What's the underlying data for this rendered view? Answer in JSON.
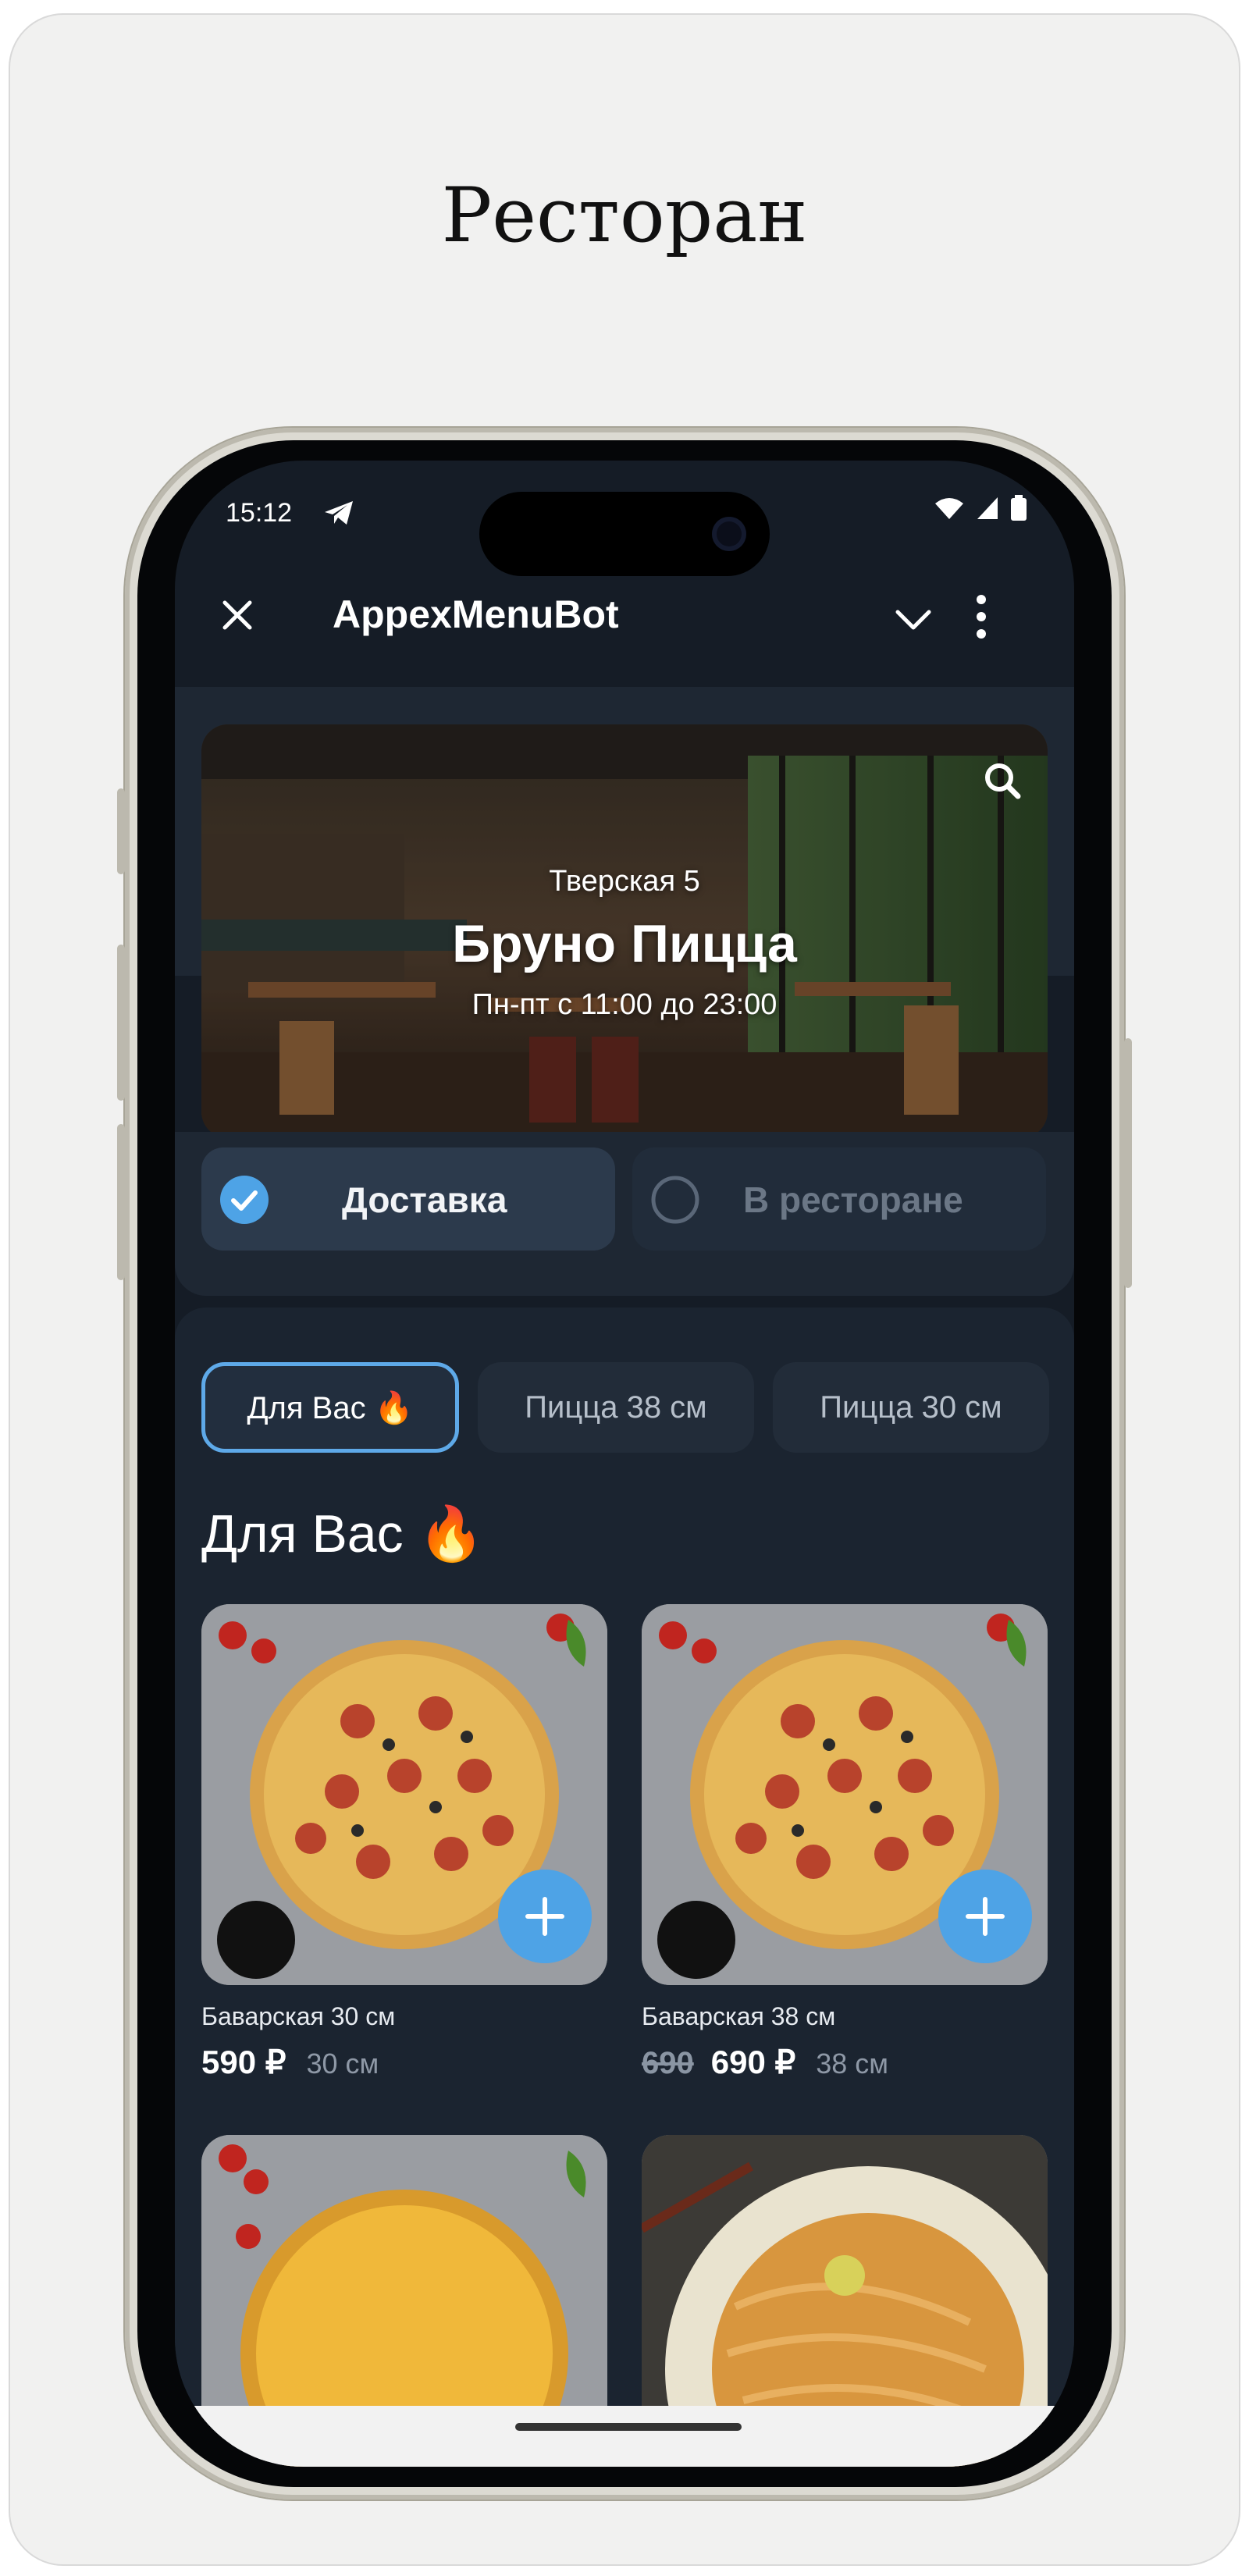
{
  "page": {
    "title": "Ресторан"
  },
  "status_bar": {
    "time": "15:12"
  },
  "header": {
    "title": "AppexMenuBot"
  },
  "hero": {
    "address": "Тверская 5",
    "restaurant_name": "Бруно Пицца",
    "hours": "Пн-пт с 11:00 до 23:00"
  },
  "order_mode": {
    "options": [
      {
        "label": "Доставка",
        "selected": true
      },
      {
        "label": "В ресторане",
        "selected": false
      }
    ]
  },
  "categories": [
    {
      "label": "Для Вас 🔥",
      "active": true
    },
    {
      "label": "Пицца 38 см",
      "active": false
    },
    {
      "label": "Пицца 30 см",
      "active": false
    }
  ],
  "section": {
    "title": "Для Вас 🔥"
  },
  "products": [
    {
      "name": "Баварская 30 см",
      "price": "590 ₽",
      "old_price": "",
      "size": "30 см"
    },
    {
      "name": "Баварская 38 см",
      "price": "690 ₽",
      "old_price": "690",
      "size": "38 см"
    }
  ],
  "colors": {
    "accent": "#4ea3e6",
    "background": "#151c26",
    "panel": "#1e2733"
  },
  "icons": {
    "close": "close-icon",
    "chevron": "chevron-down-icon",
    "more": "more-vertical-icon",
    "search": "search-icon",
    "check": "check-circle-icon",
    "radio": "radio-empty-icon",
    "add": "plus-icon",
    "telegram": "telegram-icon",
    "wifi": "wifi-icon",
    "signal": "signal-icon",
    "battery": "battery-icon"
  }
}
